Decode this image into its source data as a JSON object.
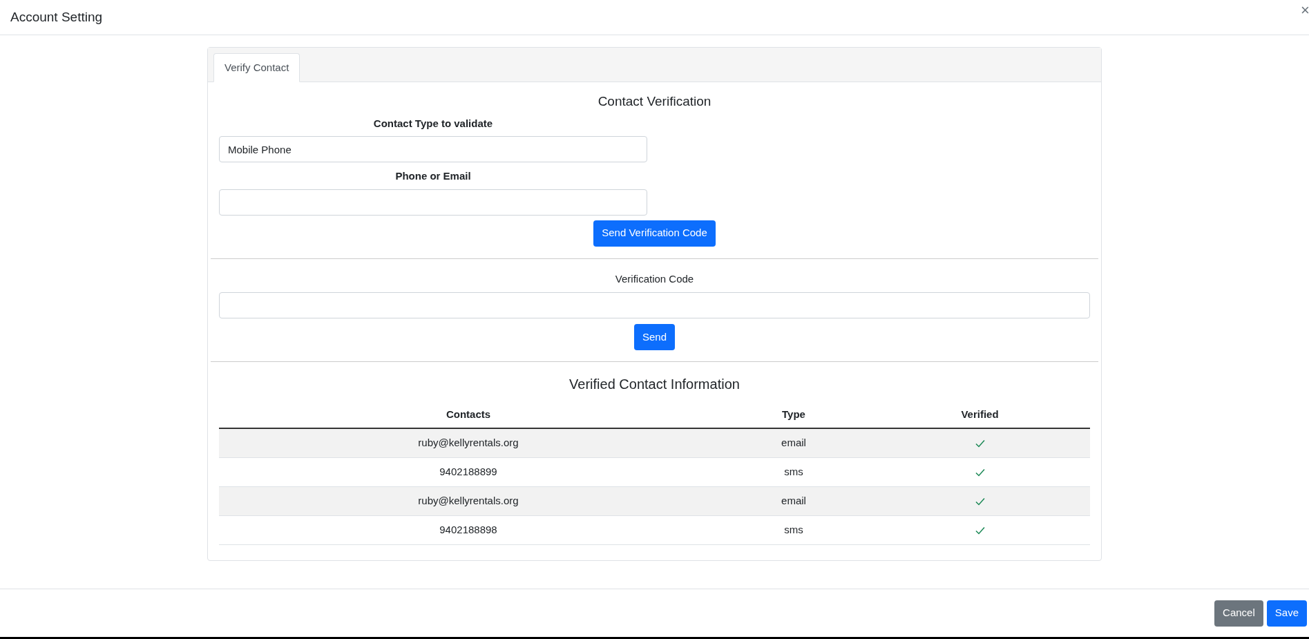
{
  "window": {
    "title": "Account Setting",
    "close": "×"
  },
  "tabs": [
    {
      "label": "Verify Contact",
      "selected": true
    }
  ],
  "verification": {
    "title": "Contact Verification",
    "contact_type": {
      "label": "Contact Type to validate",
      "value": "Mobile Phone"
    },
    "phone_or_email": {
      "label": "Phone or Email"
    },
    "send_code_button": "Send Verification Code",
    "code": {
      "label": "Verification Code"
    },
    "send_button": "Send"
  },
  "table": {
    "title": "Verified Contact Information",
    "columns": [
      "Contacts",
      "Type",
      "Verified"
    ],
    "rows": [
      {
        "contact": "ruby@kellyrentals.org",
        "type": "email",
        "verified": true
      },
      {
        "contact": "9402188899",
        "type": "sms",
        "verified": true
      },
      {
        "contact": "ruby@kellyrentals.org",
        "type": "email",
        "verified": true
      },
      {
        "contact": "9402188898",
        "type": "sms",
        "verified": true
      }
    ]
  },
  "footer": {
    "buttons": [
      {
        "label": "Cancel",
        "kind": "secondary"
      },
      {
        "label": "Save",
        "kind": "primary"
      }
    ]
  }
}
